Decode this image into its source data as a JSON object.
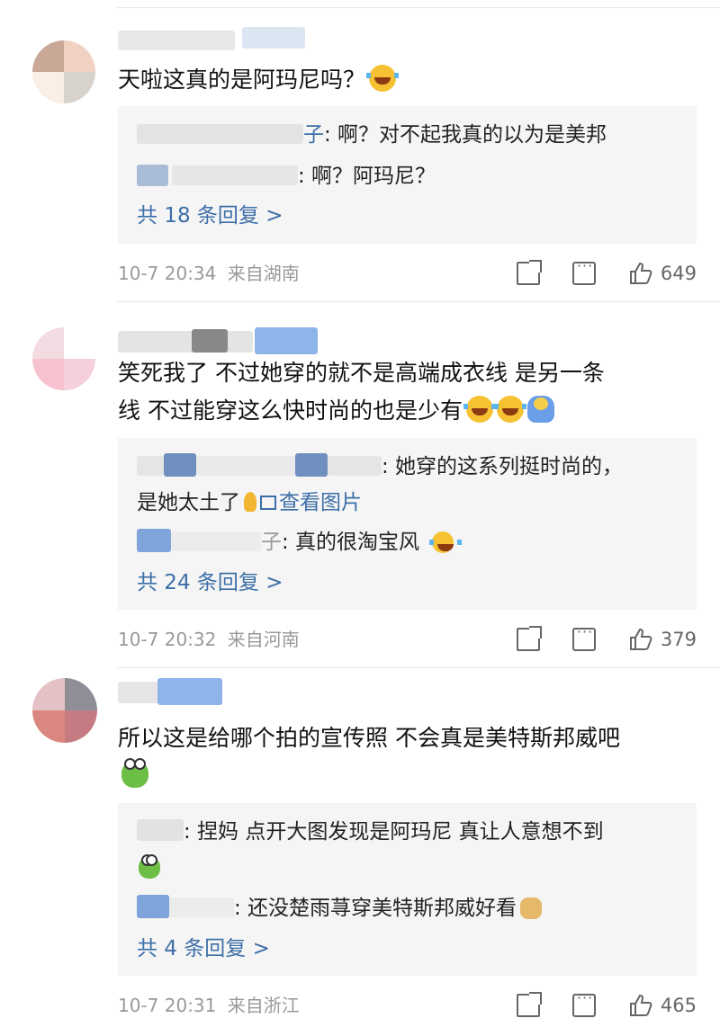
{
  "comments": [
    {
      "text": "天啦这真的是阿玛尼吗？",
      "replies": [
        {
          "name_tail": "子",
          "text": ": 啊？对不起我真的以为是美邦"
        },
        {
          "name_tail": "",
          "text": ": 啊？阿玛尼？"
        }
      ],
      "more": "共 18 条回复 >",
      "time": "10-7 20:34",
      "source": "来自湖南",
      "likes": "649"
    },
    {
      "text_line1": "笑死我了  不过她穿的就不是高端成衣线   是另一条",
      "text_line2": "线  不过能穿这么快时尚的也是少有",
      "replies": [
        {
          "name_tail": "",
          "text": ": 她穿的这系列挺时尚的，"
        },
        {
          "name_tail": "",
          "text": "是她太土了"
        },
        {
          "name_tail": "子",
          "text": ": 真的很淘宝风"
        }
      ],
      "view_image": "查看图片",
      "more": "共 24 条回复 >",
      "time": "10-7 20:32",
      "source": "来自河南",
      "likes": "379"
    },
    {
      "text": "所以这是给哪个拍的宣传照 不会真是美特斯邦威吧",
      "replies": [
        {
          "name_tail": "",
          "text": ": 捏妈 点开大图发现是阿玛尼 真让人意想不到"
        },
        {
          "name_tail": "",
          "text": ": 还没楚雨荨穿美特斯邦威好看"
        }
      ],
      "more": "共 4 条回复 >",
      "time": "10-7 20:31",
      "source": "来自浙江",
      "likes": "465"
    }
  ],
  "icons": {
    "forward": "forward-icon",
    "comment": "comment-icon",
    "like": "like-icon",
    "laugh": "laugh-cry-emoji",
    "frog": "frog-emoji",
    "doge": "doge-emoji"
  },
  "colors": {
    "link": "#3d6fa8",
    "reply_bg": "#f5f5f5",
    "meta": "#999999"
  }
}
